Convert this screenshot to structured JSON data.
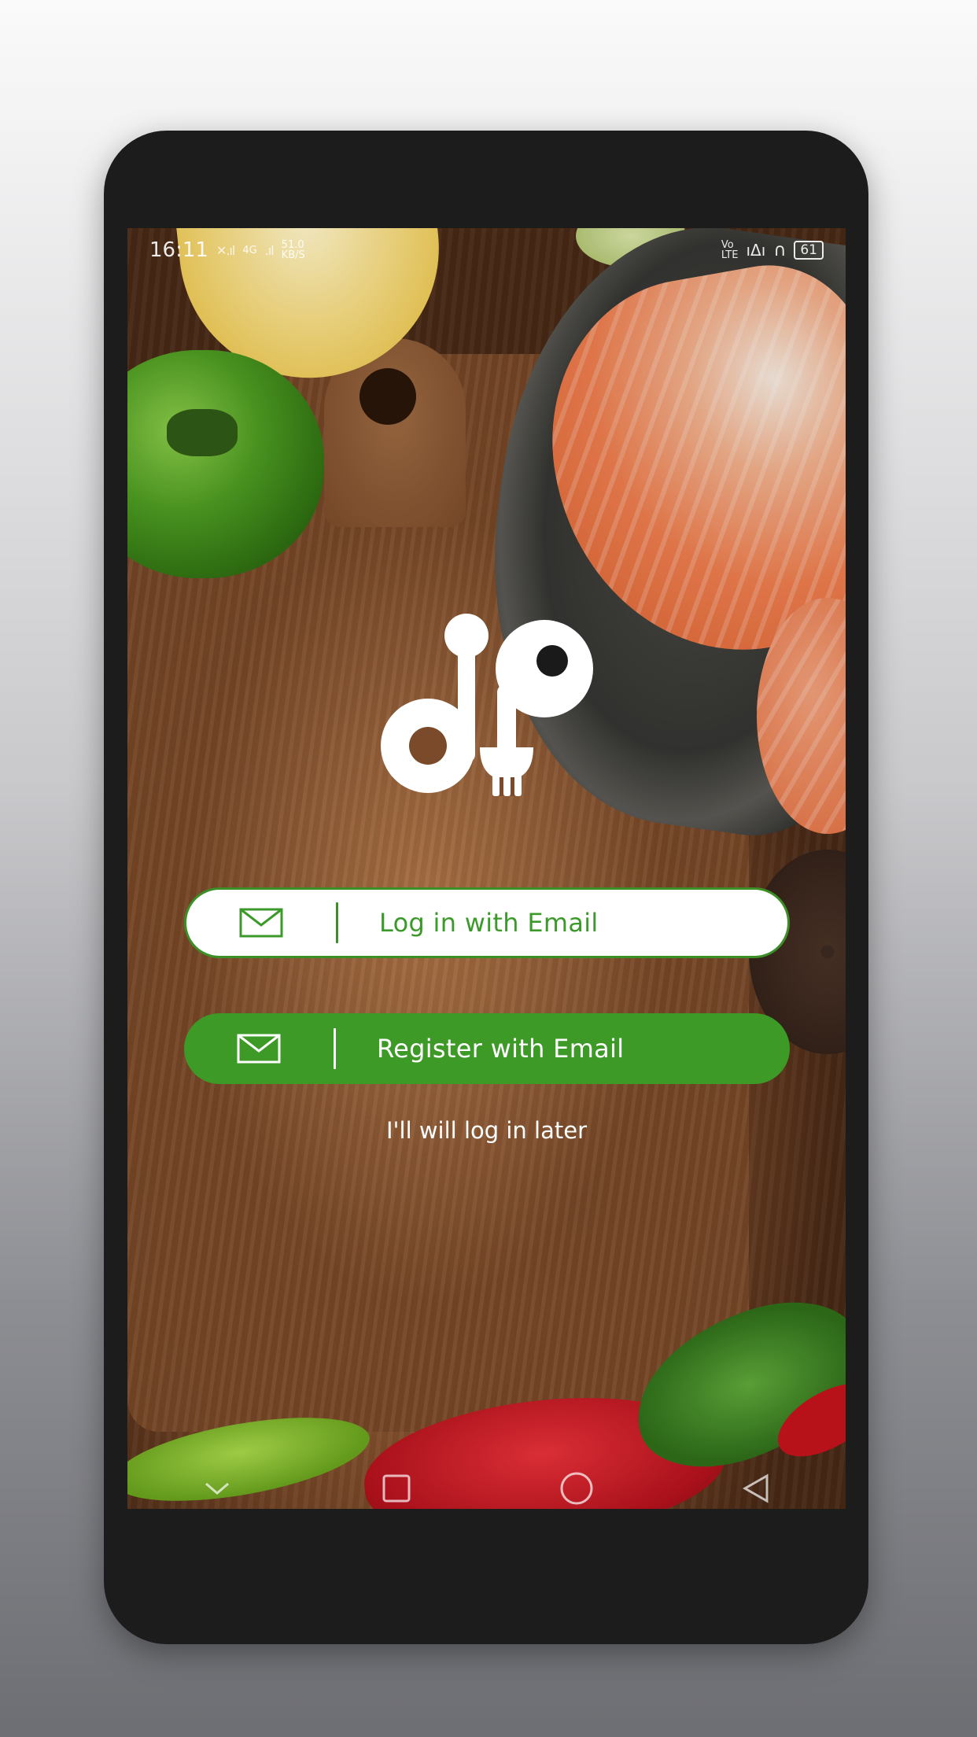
{
  "status_bar": {
    "time": "16:11",
    "network_speed_value": "51.0",
    "network_speed_unit": "KB/S",
    "network_type_top": "Vo",
    "network_type_bottom": "LTE",
    "battery_level": "61",
    "signal_4g_label": "4G"
  },
  "logo": {
    "icon": "dp-fork-spoon-logo"
  },
  "actions": {
    "login_label": "Log in with Email",
    "register_label": "Register with Email",
    "later_label": "I'll will log in later",
    "login_icon": "mail-icon",
    "register_icon": "mail-icon"
  },
  "colors": {
    "accent_green": "#3d9a27",
    "login_border": "#3b8f26",
    "phone_frame": "#1c1c1c"
  },
  "nav_bar": {
    "icons": [
      "chevron-down-icon",
      "recent-apps-icon",
      "home-icon",
      "back-icon"
    ]
  }
}
